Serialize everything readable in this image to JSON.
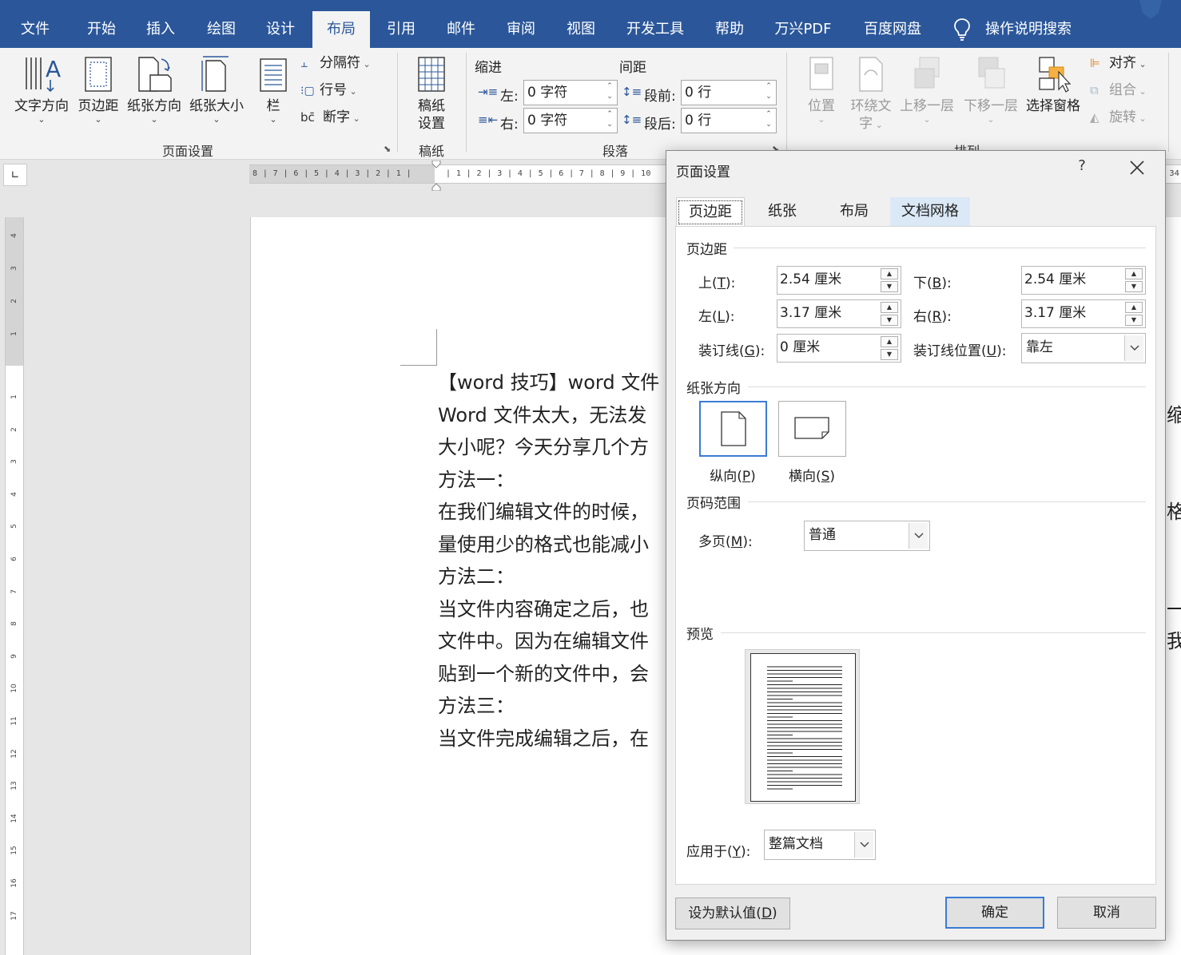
{
  "menubar": {
    "tabs": [
      "文件",
      "开始",
      "插入",
      "绘图",
      "设计",
      "布局",
      "引用",
      "邮件",
      "审阅",
      "视图",
      "开发工具",
      "帮助",
      "万兴PDF",
      "百度网盘"
    ],
    "active_tab": "布局",
    "search_label": "操作说明搜索",
    "accent": "#2b579a"
  },
  "ribbon": {
    "page_setup": {
      "text_direction": "文字方向",
      "margins": "页边距",
      "orientation": "纸张方向",
      "size": "纸张大小",
      "columns": "栏",
      "breaks": "分隔符",
      "line_numbers": "行号",
      "hyphenation": "断字",
      "group_label": "页面设置"
    },
    "manuscript": {
      "button": [
        "稿纸",
        "设置"
      ],
      "group_label": "稿纸"
    },
    "paragraph": {
      "indent_header": "缩进",
      "spacing_header": "间距",
      "left_label": "左:",
      "right_label": "右:",
      "before_label": "段前:",
      "after_label": "段后:",
      "indent_left": "0 字符",
      "indent_right": "0 字符",
      "space_before": "0 行",
      "space_after": "0 行",
      "group_label": "段落"
    },
    "arrange": {
      "position": "位置",
      "wrap_text": [
        "环绕文",
        "字"
      ],
      "bring_forward": "上移一层",
      "send_backward": "下移一层",
      "selection_pane": "选择窗格",
      "align": "对齐",
      "group": "组合",
      "rotate": "旋转",
      "group_label": "排列"
    }
  },
  "rulers": {
    "horizontal_left": "8 | 7 | 6 | 5 | 4 | 3 | 2 | 1 |",
    "horizontal_right": "| 1 | 2 | 3 | 4 | 5 | 6 | 7 | 8 | 9 | 10",
    "horizontal_end": "34",
    "vertical_top": [
      "4",
      "3",
      "2",
      "1"
    ],
    "vertical_main": [
      "1",
      "2",
      "3",
      "4",
      "5",
      "6",
      "7",
      "8",
      "9",
      "10",
      "11",
      "12",
      "13",
      "14",
      "15",
      "16",
      "17"
    ]
  },
  "document": {
    "lines": [
      "【word 技巧】word 文件",
      "Word 文件太大，无法发",
      "大小呢？今天分享几个方",
      "方法一：",
      "在我们编辑文件的时候，",
      "量使用少的格式也能减小",
      "方法二：",
      "当文件内容确定之后，也",
      "文件中。因为在编辑文件",
      "贴到一个新的文件中，会",
      "方法三：",
      "当文件完成编辑之后，在"
    ],
    "right_edge": [
      "",
      "缩小",
      "",
      "",
      "格式",
      "",
      "",
      "一个",
      "我",
      "",
      "",
      ""
    ]
  },
  "dialog": {
    "title": "页面设置",
    "help": "?",
    "tabs": [
      "页边距",
      "纸张",
      "布局",
      "文档网格"
    ],
    "active_tab": "页边距",
    "margins_section": "页边距",
    "top_label": "上(T):",
    "top_label_pre": "上(",
    "top_label_key": "T",
    "top_label_post": "):",
    "bottom_label_pre": "下(",
    "bottom_label_key": "B",
    "bottom_label_post": "):",
    "left_label_pre": "左(",
    "left_label_key": "L",
    "left_label_post": "):",
    "right_label_pre": "右(",
    "right_label_key": "R",
    "right_label_post": "):",
    "gutter_label_pre": "装订线(",
    "gutter_label_key": "G",
    "gutter_label_post": "):",
    "gutter_pos_label_pre": "装订线位置(",
    "gutter_pos_label_key": "U",
    "gutter_pos_label_post": "):",
    "top_value": "2.54 厘米",
    "bottom_value": "2.54 厘米",
    "left_value": "3.17 厘米",
    "right_value": "3.17 厘米",
    "gutter_value": "0 厘米",
    "gutter_position": "靠左",
    "orientation_section": "纸张方向",
    "portrait_pre": "纵向(",
    "portrait_key": "P",
    "portrait_post": ")",
    "landscape_pre": "横向(",
    "landscape_key": "S",
    "landscape_post": ")",
    "orientation_selected": "portrait",
    "pages_section": "页码范围",
    "multiple_pages_pre": "多页(",
    "multiple_pages_key": "M",
    "multiple_pages_post": "):",
    "multiple_pages_value": "普通",
    "preview_section": "预览",
    "apply_to_pre": "应用于(",
    "apply_to_key": "Y",
    "apply_to_post": "):",
    "apply_to_value": "整篇文档",
    "set_default_pre": "设为默认值(",
    "set_default_key": "D",
    "set_default_post": ")",
    "ok": "确定",
    "cancel": "取消"
  }
}
